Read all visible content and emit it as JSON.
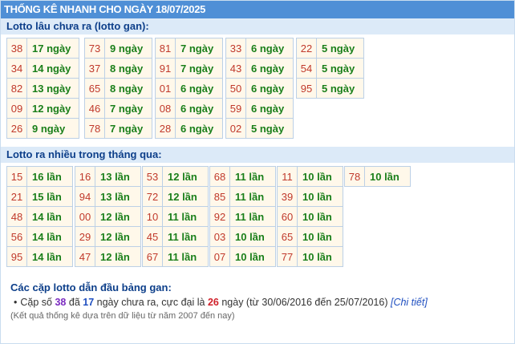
{
  "header": {
    "title": "THỐNG KÊ NHANH CHO NGÀY 18/07/2025"
  },
  "gan": {
    "title": "Lotto lâu chưa ra (lotto gan):",
    "columns": [
      [
        {
          "num": "38",
          "count": "17 ngày"
        },
        {
          "num": "34",
          "count": "14 ngày"
        },
        {
          "num": "82",
          "count": "13 ngày"
        },
        {
          "num": "09",
          "count": "12 ngày"
        },
        {
          "num": "26",
          "count": "9 ngày"
        }
      ],
      [
        {
          "num": "73",
          "count": "9 ngày"
        },
        {
          "num": "37",
          "count": "8 ngày"
        },
        {
          "num": "65",
          "count": "8 ngày"
        },
        {
          "num": "46",
          "count": "7 ngày"
        },
        {
          "num": "78",
          "count": "7 ngày"
        }
      ],
      [
        {
          "num": "81",
          "count": "7 ngày"
        },
        {
          "num": "91",
          "count": "7 ngày"
        },
        {
          "num": "01",
          "count": "6 ngày"
        },
        {
          "num": "08",
          "count": "6 ngày"
        },
        {
          "num": "28",
          "count": "6 ngày"
        }
      ],
      [
        {
          "num": "33",
          "count": "6 ngày"
        },
        {
          "num": "43",
          "count": "6 ngày"
        },
        {
          "num": "50",
          "count": "6 ngày"
        },
        {
          "num": "59",
          "count": "6 ngày"
        },
        {
          "num": "02",
          "count": "5 ngày"
        }
      ],
      [
        {
          "num": "22",
          "count": "5 ngày"
        },
        {
          "num": "54",
          "count": "5 ngày"
        },
        {
          "num": "95",
          "count": "5 ngày"
        }
      ]
    ]
  },
  "frequent": {
    "title": "Lotto ra nhiều trong tháng qua:",
    "columns": [
      [
        {
          "num": "15",
          "count": "16 lần"
        },
        {
          "num": "21",
          "count": "15 lần"
        },
        {
          "num": "48",
          "count": "14 lần"
        },
        {
          "num": "56",
          "count": "14 lần"
        },
        {
          "num": "95",
          "count": "14 lần"
        }
      ],
      [
        {
          "num": "16",
          "count": "13 lần"
        },
        {
          "num": "94",
          "count": "13 lần"
        },
        {
          "num": "00",
          "count": "12 lần"
        },
        {
          "num": "29",
          "count": "12 lần"
        },
        {
          "num": "47",
          "count": "12 lần"
        }
      ],
      [
        {
          "num": "53",
          "count": "12 lần"
        },
        {
          "num": "72",
          "count": "12 lần"
        },
        {
          "num": "10",
          "count": "11 lần"
        },
        {
          "num": "45",
          "count": "11 lần"
        },
        {
          "num": "67",
          "count": "11 lần"
        }
      ],
      [
        {
          "num": "68",
          "count": "11 lần"
        },
        {
          "num": "85",
          "count": "11 lần"
        },
        {
          "num": "92",
          "count": "11 lần"
        },
        {
          "num": "03",
          "count": "10 lần"
        },
        {
          "num": "07",
          "count": "10 lần"
        }
      ],
      [
        {
          "num": "11",
          "count": "10 lần"
        },
        {
          "num": "39",
          "count": "10 lần"
        },
        {
          "num": "60",
          "count": "10 lần"
        },
        {
          "num": "65",
          "count": "10 lần"
        },
        {
          "num": "77",
          "count": "10 lần"
        }
      ],
      [
        {
          "num": "78",
          "count": "10 lần"
        }
      ]
    ]
  },
  "pairs": {
    "title": "Các cặp lotto dẫn đầu bảng gan:",
    "line": {
      "bullet": "•",
      "t1": "Cặp số ",
      "pair": "38",
      "t2": " đã ",
      "days": "17",
      "t3": " ngày chưa ra, cực đại là ",
      "max": "26",
      "t4": " ngày (từ 30/06/2016 đến 25/07/2016) ",
      "link": "[Chi tiết]"
    }
  },
  "note": "(Kết quả thống kê dựa trên dữ liệu từ năm 2007 đến nay)"
}
